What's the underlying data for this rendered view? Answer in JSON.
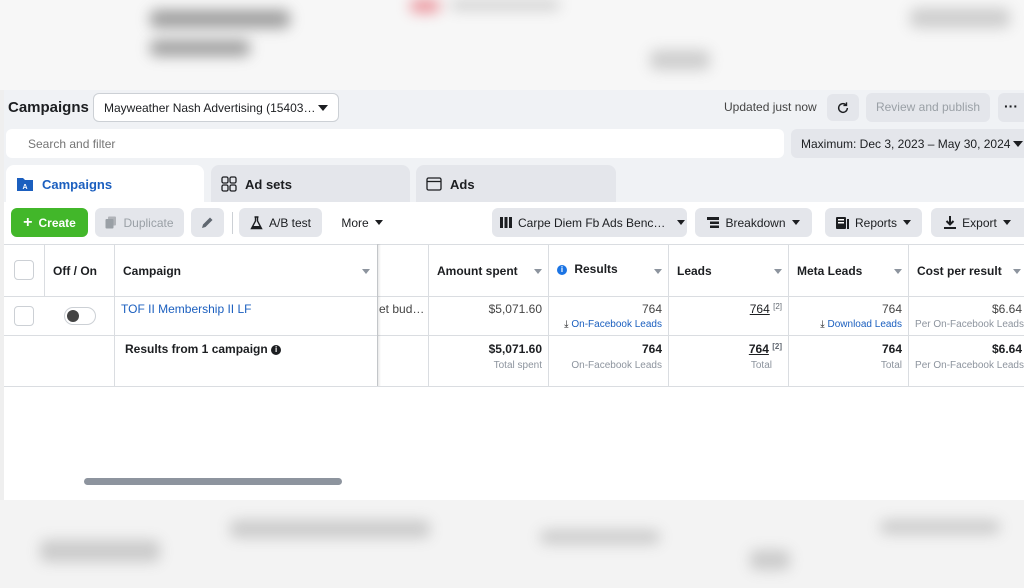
{
  "header": {
    "title": "Campaigns",
    "account": "Mayweather Nash Advertising (15403…",
    "updated": "Updated just now",
    "review_label": "Review and publish",
    "more_label": "···"
  },
  "search": {
    "placeholder": "Search and filter",
    "date_range": "Maximum: Dec 3, 2023 – May 30, 2024"
  },
  "tabs": [
    {
      "label": "Campaigns"
    },
    {
      "label": "Ad sets"
    },
    {
      "label": "Ads"
    }
  ],
  "toolbar": {
    "create": "Create",
    "duplicate": "Duplicate",
    "ab_test": "A/B test",
    "more": "More",
    "columns": "Carpe Diem Fb Ads Benc…",
    "breakdown": "Breakdown",
    "reports": "Reports",
    "export": "Export"
  },
  "table": {
    "headers": {
      "off_on": "Off / On",
      "campaign": "Campaign",
      "amount_spent": "Amount spent",
      "results": "Results",
      "leads": "Leads",
      "meta_leads": "Meta Leads",
      "cost_per_result": "Cost per result"
    },
    "row": {
      "campaign_name": "TOF II Membership II LF",
      "budget_fragment": "et bud…",
      "amount_spent": "$5,071.60",
      "results": "764",
      "results_sub": "On-Facebook Leads",
      "leads": "764",
      "leads_sup": "[2]",
      "meta_leads": "764",
      "meta_leads_sub": "Download Leads",
      "cost_per_result": "$6.64",
      "cost_sub": "Per On-Facebook Leads"
    },
    "summary": {
      "label": "Results from 1 campaign",
      "amount_spent": "$5,071.60",
      "amount_sub": "Total spent",
      "results": "764",
      "results_sub": "On-Facebook Leads",
      "leads": "764",
      "leads_sup": "[2]",
      "leads_sub": "Total",
      "meta_leads": "764",
      "meta_leads_sub": "Total",
      "cost_per_result": "$6.64",
      "cost_sub": "Per On-Facebook Leads"
    }
  },
  "colors": {
    "accent": "#1b5fbf",
    "create_green": "#42b72a"
  },
  "icons": [
    "refresh-icon",
    "campaign-icon",
    "adsets-icon",
    "ads-icon",
    "plus-icon",
    "duplicate-icon",
    "pencil-icon",
    "flask-icon",
    "columns-icon",
    "breakdown-icon",
    "reports-icon",
    "download-icon",
    "info-icon"
  ]
}
